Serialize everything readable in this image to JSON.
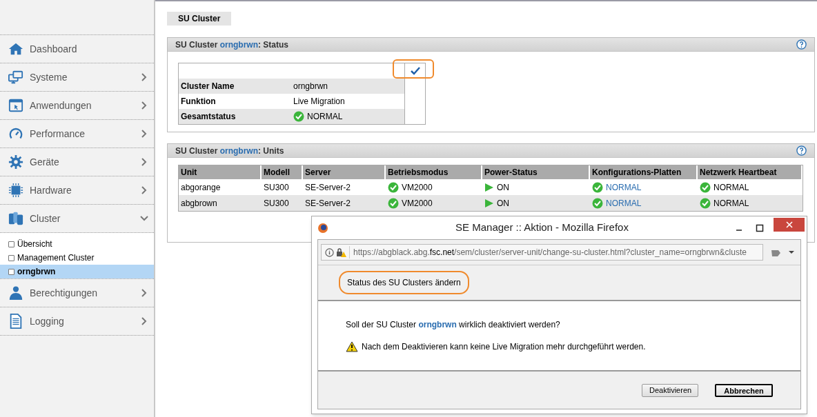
{
  "sidebar": {
    "items": [
      {
        "label": "Dashboard",
        "has_arrow": false
      },
      {
        "label": "Systeme",
        "has_arrow": true,
        "expanded": false
      },
      {
        "label": "Anwendungen",
        "has_arrow": true,
        "expanded": false
      },
      {
        "label": "Performance",
        "has_arrow": true,
        "expanded": false
      },
      {
        "label": "Geräte",
        "has_arrow": true,
        "expanded": false
      },
      {
        "label": "Hardware",
        "has_arrow": true,
        "expanded": false
      },
      {
        "label": "Cluster",
        "has_arrow": true,
        "expanded": true,
        "children": [
          {
            "label": "Übersicht",
            "selected": false
          },
          {
            "label": "Management Cluster",
            "selected": false
          },
          {
            "label": "orngbrwn",
            "selected": true
          }
        ]
      },
      {
        "label": "Berechtigungen",
        "has_arrow": true,
        "expanded": false
      },
      {
        "label": "Logging",
        "has_arrow": true,
        "expanded": false
      }
    ]
  },
  "page_tab": "SU Cluster",
  "status_panel": {
    "title_prefix": "SU Cluster",
    "cluster": "orngbrwn",
    "title_suffix": ": Status",
    "rows": [
      {
        "label": "Cluster Name",
        "value": "orngbrwn",
        "kind": "text"
      },
      {
        "label": "Funktion",
        "value": "Live Migration",
        "kind": "text"
      },
      {
        "label": "Gesamtstatus",
        "value": "NORMAL",
        "kind": "ok"
      }
    ]
  },
  "units_panel": {
    "title_prefix": "SU Cluster",
    "cluster": "orngbrwn",
    "title_suffix": ": Units",
    "columns": [
      "Unit",
      "Modell",
      "Server",
      "Betriebsmodus",
      "Power-Status",
      "Konfigurations-Platten",
      "Netzwerk Heartbeat"
    ],
    "rows": [
      [
        {
          "text": "abgorange",
          "kind": "text"
        },
        {
          "text": "SU300",
          "kind": "text"
        },
        {
          "text": "SE-Server-2",
          "kind": "text"
        },
        {
          "text": "VM2000",
          "kind": "ok"
        },
        {
          "text": "ON",
          "kind": "on"
        },
        {
          "text": "NORMAL",
          "kind": "ok_link"
        },
        {
          "text": "NORMAL",
          "kind": "ok"
        }
      ],
      [
        {
          "text": "abgbrown",
          "kind": "text"
        },
        {
          "text": "SU300",
          "kind": "text"
        },
        {
          "text": "SE-Server-2",
          "kind": "text"
        },
        {
          "text": "VM2000",
          "kind": "ok"
        },
        {
          "text": "ON",
          "kind": "on"
        },
        {
          "text": "NORMAL",
          "kind": "ok_link"
        },
        {
          "text": "NORMAL",
          "kind": "ok"
        }
      ]
    ]
  },
  "dialog": {
    "title": "SE Manager :: Aktion - Mozilla Firefox",
    "url_start": "https://abgblack.abg.",
    "url_host": "fsc.net",
    "url_rest": "/sem/cluster/server-unit/change-su-cluster.html?cluster_name=orngbrwn&cluste",
    "heading": "Status des SU Clusters ändern",
    "question_prefix": "Soll der SU Cluster",
    "question_name": "orngbrwn",
    "question_suffix": "wirklich deaktiviert werden?",
    "warning": "Nach dem Deaktivieren kann keine Live Migration mehr durchgeführt werden.",
    "buttons": [
      {
        "label": "Deaktivieren",
        "default": false
      },
      {
        "label": "Abbrechen",
        "default": true
      }
    ]
  }
}
